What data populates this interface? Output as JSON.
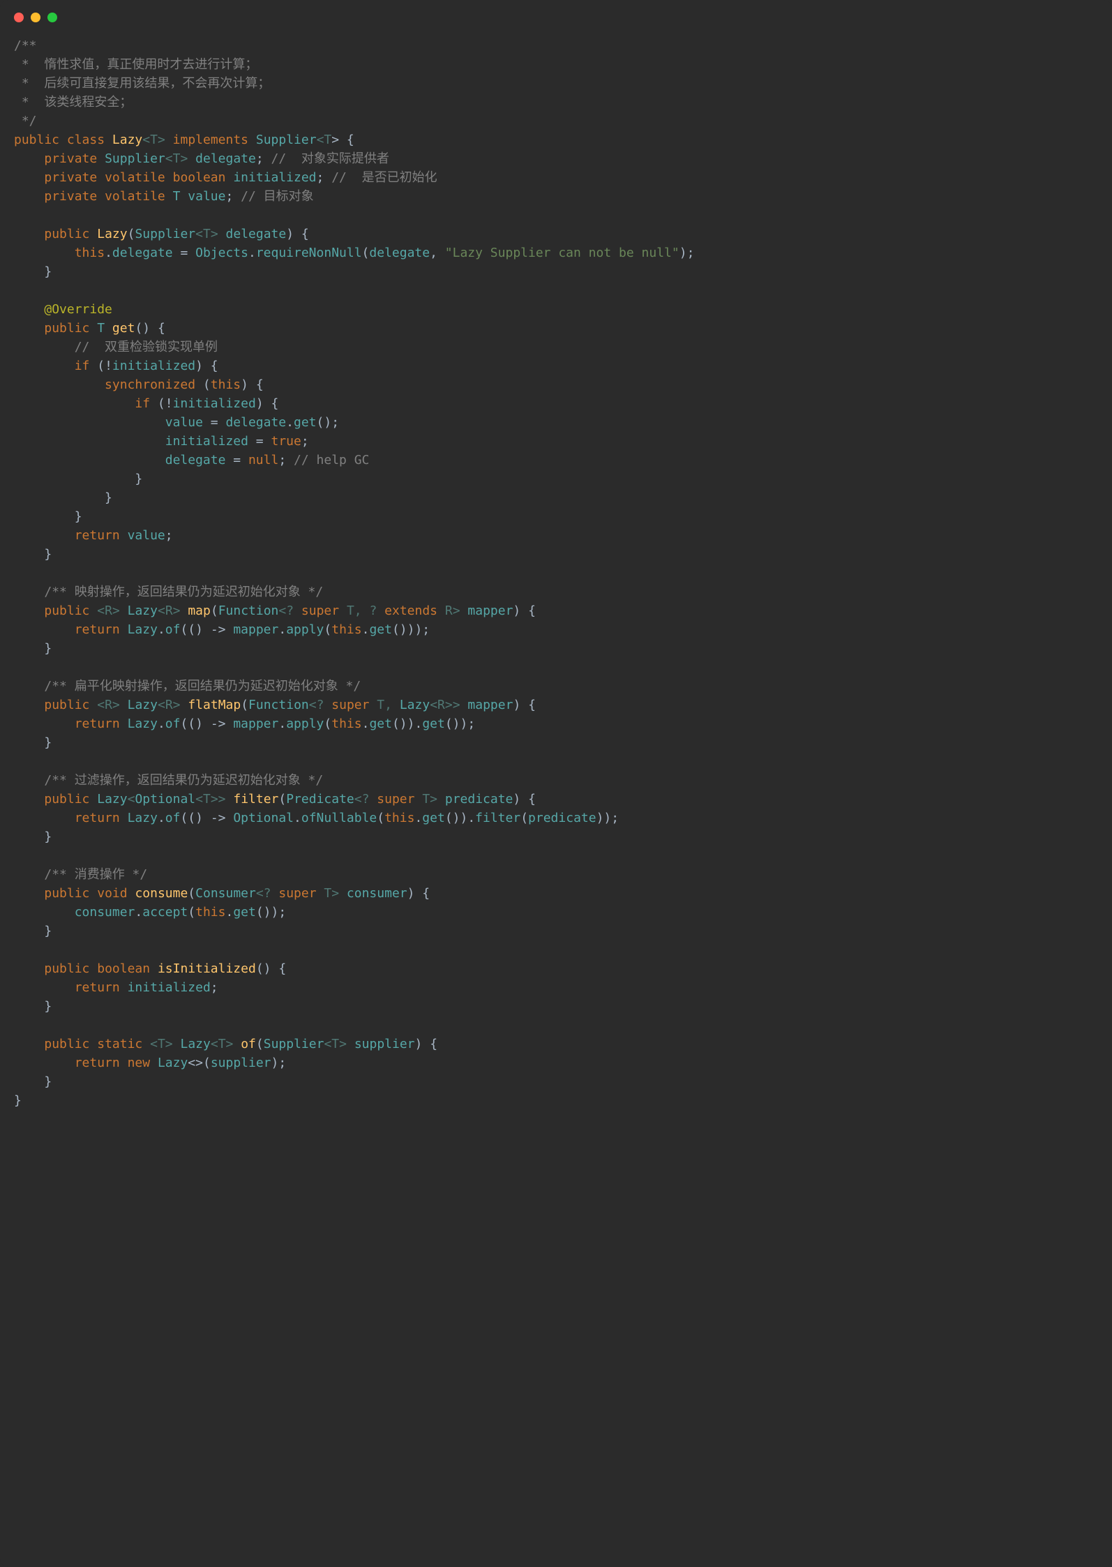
{
  "titlebar": {
    "red": "close",
    "yellow": "minimize",
    "green": "zoom"
  },
  "code": {
    "l01": "/**",
    "l02": " *  惰性求值，真正使用时才去进行计算；",
    "l03": " *  后续可直接复用该结果，不会再次计算；",
    "l04": " *  该类线程安全；",
    "l05": " */",
    "l06a": "public",
    "l06b": "class",
    "l06c": "Lazy",
    "l06d": "<",
    "l06e": "T",
    "l06f": ">",
    "l06g": "implements",
    "l06h": "Supplier",
    "l06i": "<",
    "l06j": "T",
    "l06k": "> {",
    "l07a": "private",
    "l07b": "Supplier",
    "l07c": "<",
    "l07d": "T",
    "l07e": ">",
    "l07f": "delegate",
    "l07g": ";",
    "l07h": "//  对象实际提供者",
    "l08a": "private",
    "l08b": "volatile",
    "l08c": "boolean",
    "l08d": "initialized",
    "l08e": ";",
    "l08f": "//  是否已初始化",
    "l09a": "private",
    "l09b": "volatile",
    "l09c": "T",
    "l09d": "value",
    "l09e": ";",
    "l09f": "// 目标对象",
    "l11a": "public",
    "l11b": "Lazy",
    "l11c": "(",
    "l11d": "Supplier",
    "l11e": "<",
    "l11f": "T",
    "l11g": ">",
    "l11h": "delegate",
    "l11i": ") {",
    "l12a": "this",
    "l12b": ".",
    "l12c": "delegate",
    "l12d": " = ",
    "l12e": "Objects",
    "l12f": ".",
    "l12g": "requireNonNull",
    "l12h": "(",
    "l12i": "delegate",
    "l12j": ", ",
    "l12k": "\"Lazy Supplier can not be null\"",
    "l12l": ");",
    "l13": "}",
    "l15": "@Override",
    "l16a": "public",
    "l16b": "T",
    "l16c": "get",
    "l16d": "() {",
    "l17": "//  双重检验锁实现单例",
    "l18a": "if",
    "l18b": " (!",
    "l18c": "initialized",
    "l18d": ") {",
    "l19a": "synchronized",
    "l19b": " (",
    "l19c": "this",
    "l19d": ") {",
    "l20a": "if",
    "l20b": " (!",
    "l20c": "initialized",
    "l20d": ") {",
    "l21a": "value",
    "l21b": " = ",
    "l21c": "delegate",
    "l21d": ".",
    "l21e": "get",
    "l21f": "();",
    "l22a": "initialized",
    "l22b": " = ",
    "l22c": "true",
    "l22d": ";",
    "l23a": "delegate",
    "l23b": " = ",
    "l23c": "null",
    "l23d": ";",
    "l23e": "// help GC",
    "l24": "}",
    "l25": "}",
    "l26": "}",
    "l27a": "return",
    "l27b": "value",
    "l27c": ";",
    "l28": "}",
    "l30": "/** 映射操作，返回结果仍为延迟初始化对象 */",
    "l31a": "public",
    "l31b": "<",
    "l31c": "R",
    "l31d": ">",
    "l31e": "Lazy",
    "l31f": "<",
    "l31g": "R",
    "l31h": ">",
    "l31i": "map",
    "l31j": "(",
    "l31k": "Function",
    "l31l": "<? ",
    "l31m": "super",
    "l31n": "T",
    "l31o": ", ? ",
    "l31p": "extends",
    "l31q": "R",
    "l31r": ">",
    "l31s": "mapper",
    "l31t": ") {",
    "l32a": "return",
    "l32b": "Lazy",
    "l32c": ".",
    "l32d": "of",
    "l32e": "(() -> ",
    "l32f": "mapper",
    "l32g": ".",
    "l32h": "apply",
    "l32i": "(",
    "l32j": "this",
    "l32k": ".",
    "l32l": "get",
    "l32m": "()));",
    "l33": "}",
    "l35": "/** 扁平化映射操作，返回结果仍为延迟初始化对象 */",
    "l36a": "public",
    "l36b": "<",
    "l36c": "R",
    "l36d": ">",
    "l36e": "Lazy",
    "l36f": "<",
    "l36g": "R",
    "l36h": ">",
    "l36i": "flatMap",
    "l36j": "(",
    "l36k": "Function",
    "l36l": "<? ",
    "l36m": "super",
    "l36n": "T",
    "l36o": ", ",
    "l36p": "Lazy",
    "l36q": "<",
    "l36r": "R",
    "l36s": ">>",
    "l36t": "mapper",
    "l36u": ") {",
    "l37a": "return",
    "l37b": "Lazy",
    "l37c": ".",
    "l37d": "of",
    "l37e": "(() -> ",
    "l37f": "mapper",
    "l37g": ".",
    "l37h": "apply",
    "l37i": "(",
    "l37j": "this",
    "l37k": ".",
    "l37l": "get",
    "l37m": "()).",
    "l37n": "get",
    "l37o": "());",
    "l38": "}",
    "l40": "/** 过滤操作，返回结果仍为延迟初始化对象 */",
    "l41a": "public",
    "l41b": "Lazy",
    "l41c": "<",
    "l41d": "Optional",
    "l41e": "<",
    "l41f": "T",
    "l41g": ">>",
    "l41h": "filter",
    "l41i": "(",
    "l41j": "Predicate",
    "l41k": "<? ",
    "l41l": "super",
    "l41m": "T",
    "l41n": ">",
    "l41o": "predicate",
    "l41p": ") {",
    "l42a": "return",
    "l42b": "Lazy",
    "l42c": ".",
    "l42d": "of",
    "l42e": "(() -> ",
    "l42f": "Optional",
    "l42g": ".",
    "l42h": "ofNullable",
    "l42i": "(",
    "l42j": "this",
    "l42k": ".",
    "l42l": "get",
    "l42m": "()).",
    "l42n": "filter",
    "l42o": "(",
    "l42p": "predicate",
    "l42q": "));",
    "l43": "}",
    "l45": "/** 消费操作 */",
    "l46a": "public",
    "l46b": "void",
    "l46c": "consume",
    "l46d": "(",
    "l46e": "Consumer",
    "l46f": "<? ",
    "l46g": "super",
    "l46h": "T",
    "l46i": ">",
    "l46j": "consumer",
    "l46k": ") {",
    "l47a": "consumer",
    "l47b": ".",
    "l47c": "accept",
    "l47d": "(",
    "l47e": "this",
    "l47f": ".",
    "l47g": "get",
    "l47h": "());",
    "l48": "}",
    "l50a": "public",
    "l50b": "boolean",
    "l50c": "isInitialized",
    "l50d": "() {",
    "l51a": "return",
    "l51b": "initialized",
    "l51c": ";",
    "l52": "}",
    "l54a": "public",
    "l54b": "static",
    "l54c": "<",
    "l54d": "T",
    "l54e": ">",
    "l54f": "Lazy",
    "l54g": "<",
    "l54h": "T",
    "l54i": ">",
    "l54j": "of",
    "l54k": "(",
    "l54l": "Supplier",
    "l54m": "<",
    "l54n": "T",
    "l54o": ">",
    "l54p": "supplier",
    "l54q": ") {",
    "l55a": "return",
    "l55b": "new",
    "l55c": "Lazy",
    "l55d": "<>(",
    "l55e": "supplier",
    "l55f": ");",
    "l56": "}",
    "l57": "}"
  }
}
